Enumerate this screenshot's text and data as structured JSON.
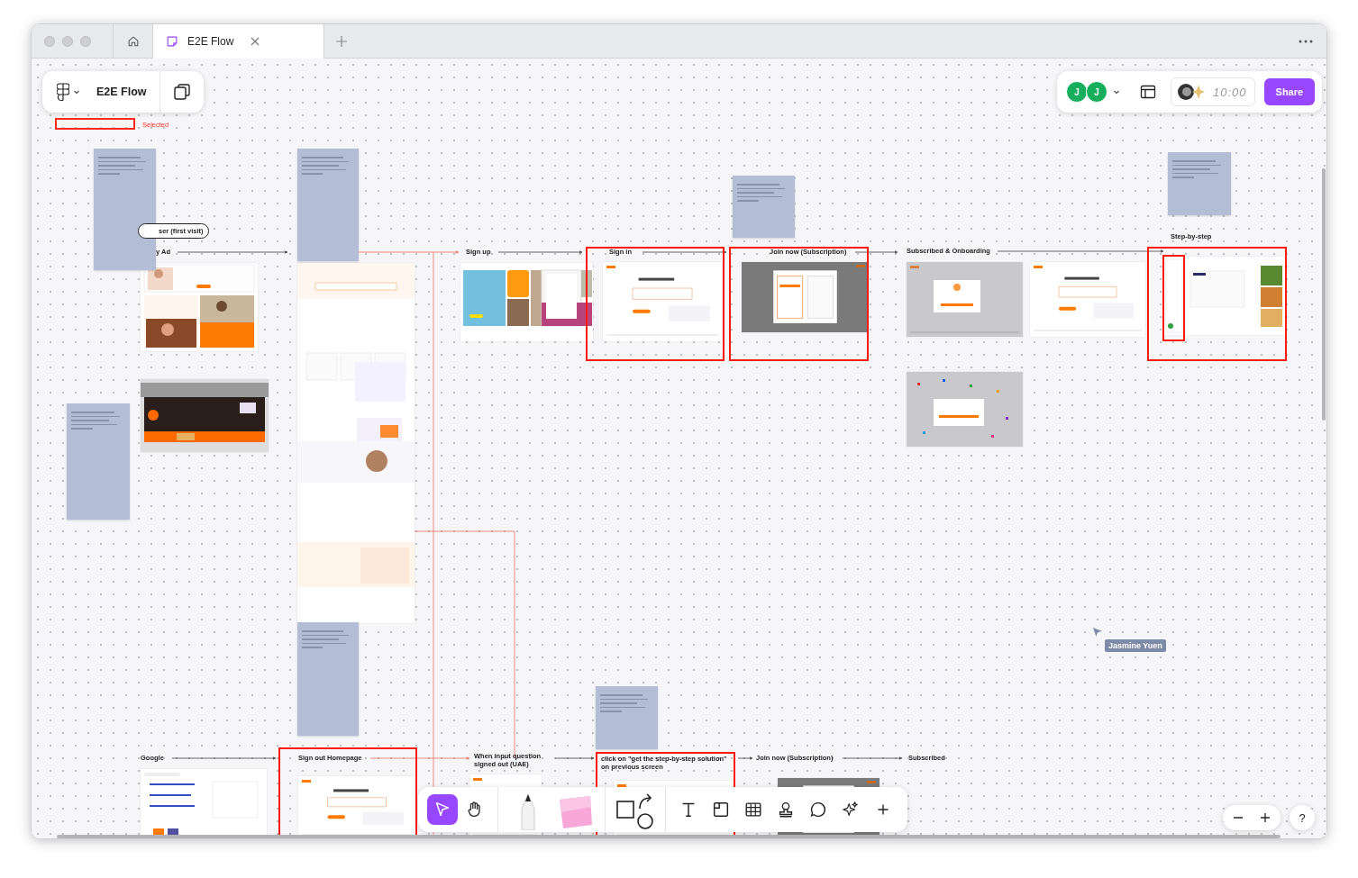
{
  "tabs": [
    {
      "kind": "home",
      "selected": false
    },
    {
      "kind": "file",
      "label": "E2E Flow",
      "selected": true
    }
  ],
  "file_menu": {
    "title": "E2E Flow"
  },
  "selection_label": "Selected",
  "collaborators": [
    {
      "initial": "J",
      "color": "#14ae5c"
    },
    {
      "initial": "J",
      "color": "#14ae5c"
    }
  ],
  "timer": "10:00",
  "share": "Share",
  "flow_labels": [
    {
      "kind": "pill",
      "text": "ser (first visit)"
    },
    {
      "kind": "plain",
      "text": "y Ad"
    },
    {
      "kind": "plain",
      "text": "Sign up"
    },
    {
      "kind": "plain",
      "text": "Sign in"
    },
    {
      "kind": "plain",
      "text": "Join now (Subscription)"
    },
    {
      "kind": "plain",
      "text": "Subscribed & Onboarding"
    },
    {
      "kind": "plain",
      "text": "Step-by-step"
    },
    {
      "kind": "plain",
      "text": "Google"
    },
    {
      "kind": "plain",
      "text": "Sign out Homepage"
    },
    {
      "kind": "plain",
      "text": "When input question signed out (UAE)"
    },
    {
      "kind": "plain",
      "text": "click on \"get the step-by-step solution\" on previous screen"
    },
    {
      "kind": "plain",
      "text": "Join now (Subscription)"
    },
    {
      "kind": "plain",
      "text": "Subscribed"
    }
  ],
  "cursor": {
    "name": "Jasmine Yuen"
  },
  "toolbar": [
    {
      "kind": "select",
      "selected": true
    },
    {
      "kind": "hand",
      "selected": false
    },
    {
      "kind": "pen",
      "selected": false
    },
    {
      "kind": "sticky",
      "selected": false
    },
    {
      "kind": "shapes",
      "selected": false
    },
    {
      "kind": "text",
      "selected": false
    },
    {
      "kind": "section",
      "selected": false
    },
    {
      "kind": "table",
      "selected": false
    },
    {
      "kind": "stamp",
      "selected": false
    },
    {
      "kind": "comment",
      "selected": false
    },
    {
      "kind": "sparkle",
      "selected": false
    },
    {
      "kind": "plus",
      "selected": false
    }
  ],
  "help": "?"
}
